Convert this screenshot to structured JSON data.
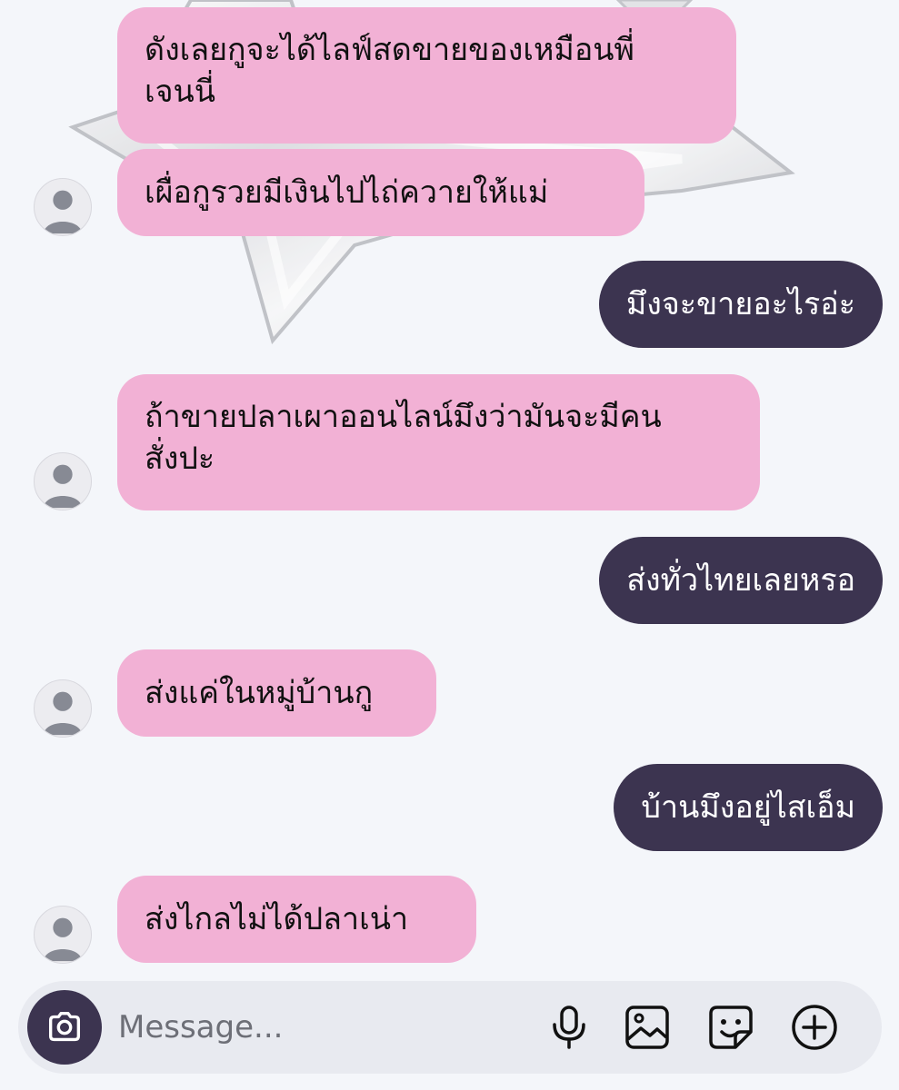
{
  "conversation": {
    "messages": [
      {
        "direction": "incoming",
        "lines": [
          "ดังเลยกูจะได้ไลฟ์สดขายของเหมือนพี่",
          "เจนนี่"
        ]
      },
      {
        "direction": "incoming",
        "text": "เผื่อกูรวยมีเงินไปไถ่ควายให้แม่"
      },
      {
        "direction": "outgoing",
        "text": "มึงจะขายอะไรอ่ะ"
      },
      {
        "direction": "incoming",
        "lines": [
          "ถ้าขายปลาเผาออนไลน์มึงว่ามันจะมีคน",
          "สั่งปะ"
        ]
      },
      {
        "direction": "outgoing",
        "text": "ส่งทั่วไทยเลยหรอ"
      },
      {
        "direction": "incoming",
        "text": "ส่งแค่ในหมู่บ้านกู"
      },
      {
        "direction": "outgoing",
        "text": "บ้านมึงอยู่ไสเอ็ม"
      },
      {
        "direction": "incoming",
        "text": "ส่งไกลไม่ได้ปลาเน่า"
      }
    ]
  },
  "composer": {
    "placeholder": "Message...",
    "icons": [
      "camera-icon",
      "microphone-icon",
      "gallery-icon",
      "sticker-icon",
      "plus-icon"
    ]
  },
  "colors": {
    "background": "#f4f6fa",
    "incoming_bubble": "#f2b1d5",
    "outgoing_bubble": "#3c3450",
    "composer_bar": "#e8eaf0"
  }
}
